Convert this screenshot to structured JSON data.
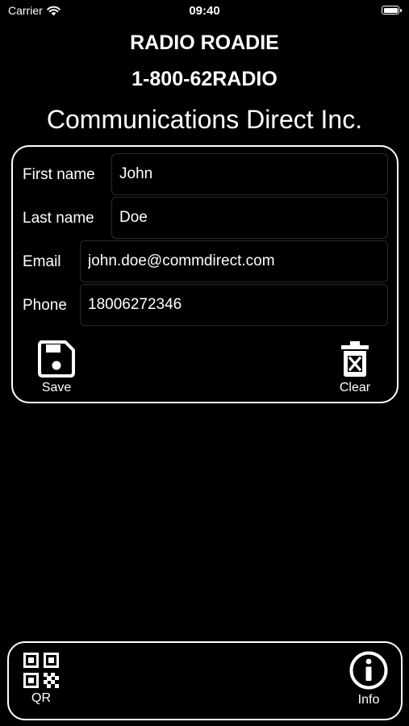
{
  "status_bar": {
    "carrier": "Carrier",
    "time": "09:40"
  },
  "header": {
    "app_title": "RADIO ROADIE",
    "phone_number": "1-800-62RADIO",
    "company_name": "Communications Direct Inc."
  },
  "form": {
    "first_name": {
      "label": "First name",
      "value": "John"
    },
    "last_name": {
      "label": "Last name",
      "value": "Doe"
    },
    "email": {
      "label": "Email",
      "value": "john.doe@commdirect.com"
    },
    "phone": {
      "label": "Phone",
      "value": "18006272346"
    },
    "save_label": "Save",
    "clear_label": "Clear"
  },
  "toolbar": {
    "qr_label": "QR",
    "info_label": "Info"
  },
  "icons": {
    "save": "floppy-disk-icon",
    "clear": "trash-x-icon",
    "qr": "qr-code-icon",
    "info": "info-circle-icon",
    "wifi": "wifi-icon",
    "battery": "battery-icon"
  },
  "colors": {
    "background": "#000000",
    "foreground": "#ffffff"
  }
}
